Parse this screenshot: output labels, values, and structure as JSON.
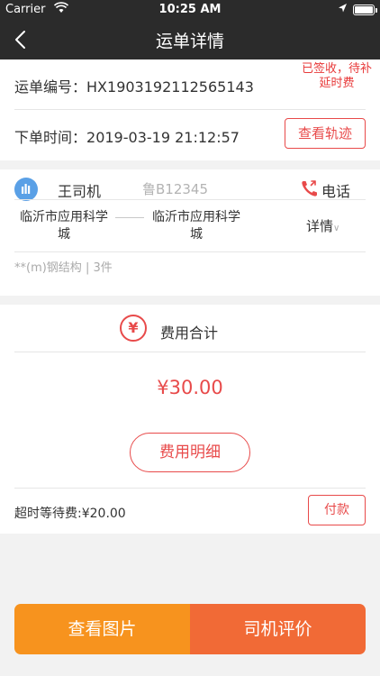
{
  "status_bar": {
    "carrier": "Carrier",
    "time": "10:25 AM"
  },
  "nav": {
    "title": "运单详情"
  },
  "order": {
    "number_label": "运单编号：",
    "number": "HX1903192112565143",
    "status": "已签收，待补延时费",
    "time_label": "下单时间：",
    "time": "2019-03-19 21:12:57",
    "track_button": "查看轨迹"
  },
  "driver": {
    "name": "王司机",
    "plate": "鲁B12345",
    "phone_label": "电话",
    "from": "临沂市应用科学城",
    "to": "临沂市应用科学城",
    "detail_label": "详情",
    "cargo": "**(m)钢结构 | 3件"
  },
  "fees": {
    "title": "费用合计",
    "total": "¥30.00",
    "detail_button": "费用明细",
    "overtime": "超时等待费:¥20.00",
    "pay_button": "付款"
  },
  "actions": {
    "view_photos": "查看图片",
    "rate_driver": "司机评价"
  },
  "colors": {
    "nav_bg": "#2b2b2b",
    "accent_red": "#e84a4a",
    "orange": "#f7931e",
    "orange_dark": "#f16a36"
  }
}
